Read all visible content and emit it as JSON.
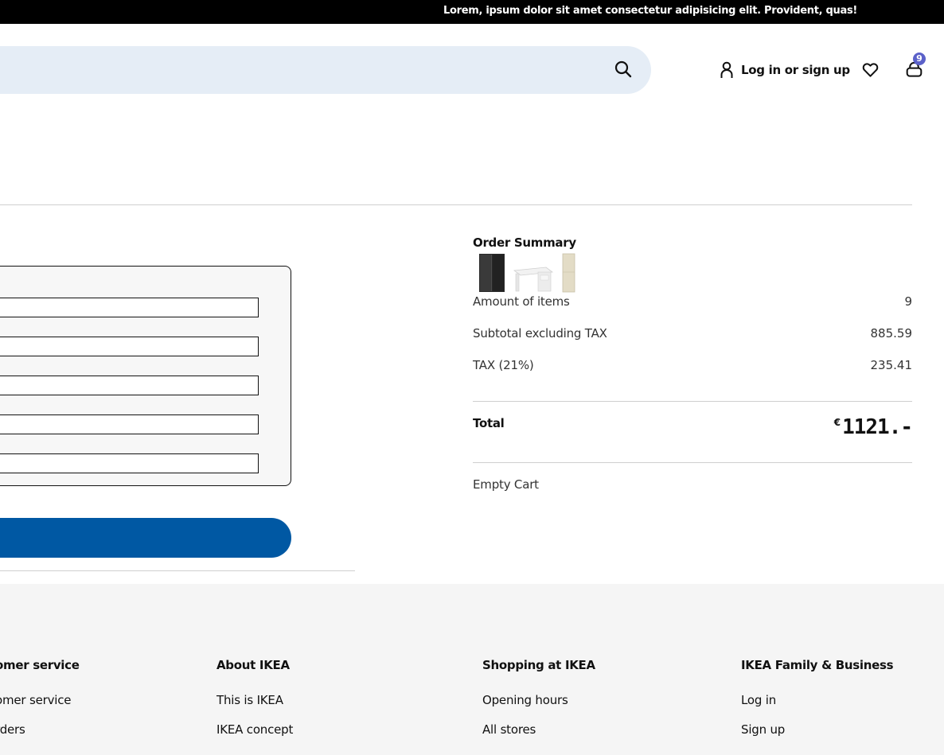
{
  "announcement": "Lorem, ipsum dolor sit amet consectetur adipisicing elit. Provident, quas!",
  "header": {
    "login_label": "Log in or sign up",
    "cart_count": "9"
  },
  "summary": {
    "title": "Order Summary",
    "rows": [
      {
        "label": "Amount of items",
        "value": "9"
      },
      {
        "label": "Subtotal excluding TAX",
        "value": "885.59"
      },
      {
        "label": "TAX (21%)",
        "value": "235.41"
      }
    ],
    "total_label": "Total",
    "currency": "€",
    "total_value": "1121.-",
    "empty_cart": "Empty Cart"
  },
  "footer": {
    "columns": [
      {
        "heading": "omer service",
        "links": [
          "omer service",
          "rders"
        ]
      },
      {
        "heading": "About IKEA",
        "links": [
          "This is IKEA",
          "IKEA concept"
        ]
      },
      {
        "heading": "Shopping at IKEA",
        "links": [
          "Opening hours",
          "All stores"
        ]
      },
      {
        "heading": "IKEA Family & Business",
        "links": [
          "Log in",
          "Sign up"
        ]
      }
    ]
  },
  "colors": {
    "accent": "#0058a3",
    "badge": "#5b61c9",
    "search_bg": "#e5edf6",
    "footer_bg": "#f5f5f5"
  }
}
